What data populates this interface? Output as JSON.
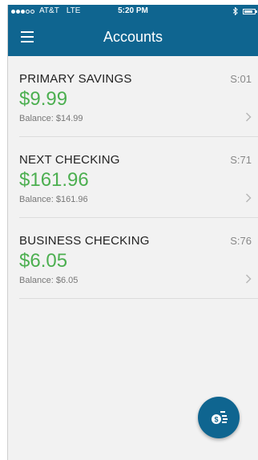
{
  "status_bar": {
    "carrier": "AT&T",
    "network": "LTE",
    "time": "5:20 PM"
  },
  "header": {
    "title": "Accounts"
  },
  "accounts": [
    {
      "name": "PRIMARY SAVINGS",
      "code": "S:01",
      "amount": "$9.99",
      "balance": "Balance: $14.99"
    },
    {
      "name": "NEXT CHECKING",
      "code": "S:71",
      "amount": "$161.96",
      "balance": "Balance: $161.96"
    },
    {
      "name": "BUSINESS CHECKING",
      "code": "S:76",
      "amount": "$6.05",
      "balance": "Balance: $6.05"
    }
  ],
  "icons": {
    "menu": "hamburger-menu-icon",
    "chevron": "chevron-right-icon",
    "fab": "money-transfer-icon"
  },
  "colors": {
    "header_bg": "#0f6590",
    "amount": "#4caf50",
    "background": "#f2f2f2"
  }
}
